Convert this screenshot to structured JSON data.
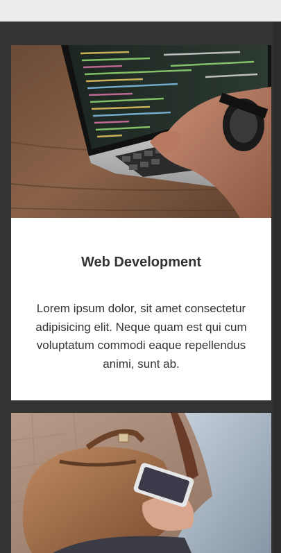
{
  "cards": [
    {
      "title": "Web Development",
      "text": "Lorem ipsum dolor, sit amet consectetur adipisicing elit. Neque quam est qui cum voluptatum commodi eaque repellendus animi, sunt ab.",
      "image": "laptop-coding-photo"
    },
    {
      "image": "phone-and-bag-photo"
    }
  ]
}
